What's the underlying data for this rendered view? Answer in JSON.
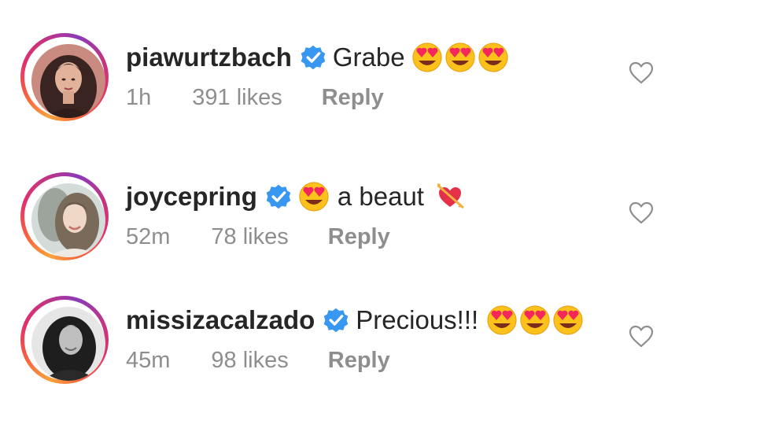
{
  "comments": [
    {
      "username": "piawurtzbach",
      "text": "Grabe",
      "emojis": [
        "heart-eyes-emoji",
        "heart-eyes-emoji",
        "heart-eyes-emoji"
      ],
      "time": "1h",
      "likes": "391 likes",
      "reply": "Reply",
      "verified": true
    },
    {
      "username": "joycepring",
      "text_prefix_emoji": "heart-eyes-emoji",
      "text": "a beaut",
      "emojis": [
        "heart-with-arrow-emoji"
      ],
      "time": "52m",
      "likes": "78 likes",
      "reply": "Reply",
      "verified": true
    },
    {
      "username": "missizacalzado",
      "text": "Precious!!!",
      "emojis": [
        "heart-eyes-emoji",
        "heart-eyes-emoji",
        "heart-eyes-emoji"
      ],
      "time": "45m",
      "likes": "98 likes",
      "reply": "Reply",
      "verified": true
    }
  ],
  "colors": {
    "text": "#262626",
    "secondary": "#8e8e8e",
    "verified_blue": "#3897f0",
    "ring_gradient": [
      "#f9a23b",
      "#e1306c",
      "#8a3ab9"
    ]
  }
}
